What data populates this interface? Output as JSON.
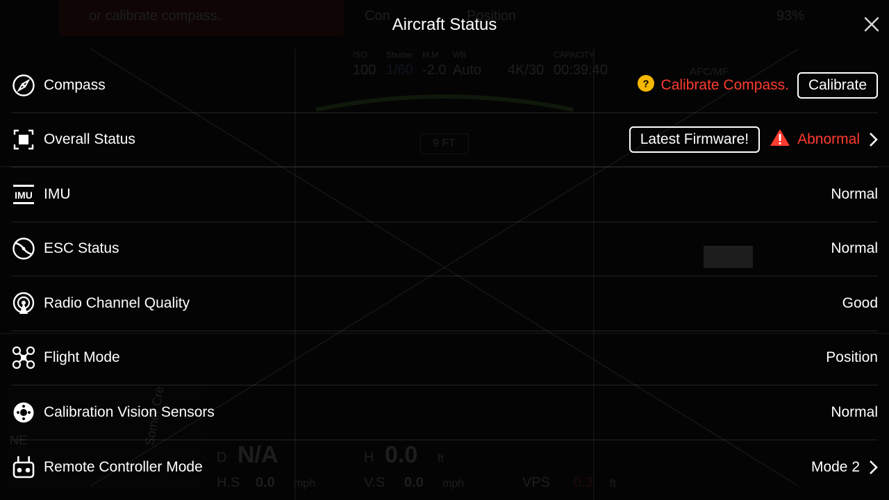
{
  "hud": {
    "banner_text": "or calibrate compass.",
    "mode_text": "Con",
    "position_text": "Position",
    "battery": "93%",
    "iso_label": "ISO",
    "iso": "100",
    "shutter_label": "Shutter",
    "shutter": "1/60",
    "mm_label": "M.M",
    "ev": "-2.0",
    "wb_label": "WB",
    "wb": "Auto",
    "res": "4K/30",
    "capacity_label": "CAPACITY",
    "capacity": "00:39:40",
    "afc": "AFC/MF",
    "altitude_box": "9 FT",
    "d_label": "D",
    "d_value": "N/A",
    "h_label": "H",
    "h_value": "0.0",
    "h_unit": "ft",
    "hs_label": "H.S",
    "hs_value": "0.0",
    "hs_unit": "mph",
    "vs_label": "V.S",
    "vs_value": "0.0",
    "vs_unit": "mph",
    "vps_label": "VPS",
    "vps_value": "0.3",
    "vps_unit": "ft",
    "compass_dir": "NE",
    "map_street": "Somer Cre"
  },
  "panel": {
    "title": "Aircraft Status",
    "rows": [
      {
        "label": "Compass",
        "warning": "Calibrate Compass.",
        "button": "Calibrate"
      },
      {
        "label": "Overall Status",
        "button": "Latest Firmware!",
        "status": "Abnormal"
      },
      {
        "label": "IMU",
        "status": "Normal"
      },
      {
        "label": "ESC Status",
        "status": "Normal"
      },
      {
        "label": "Radio Channel Quality",
        "status": "Good"
      },
      {
        "label": "Flight Mode",
        "status": "Position"
      },
      {
        "label": "Calibration Vision Sensors",
        "status": "Normal"
      },
      {
        "label": "Remote Controller Mode",
        "status": "Mode 2"
      }
    ]
  },
  "colors": {
    "warning_red": "#ff3b30",
    "help_yellow": "#f5b800"
  }
}
